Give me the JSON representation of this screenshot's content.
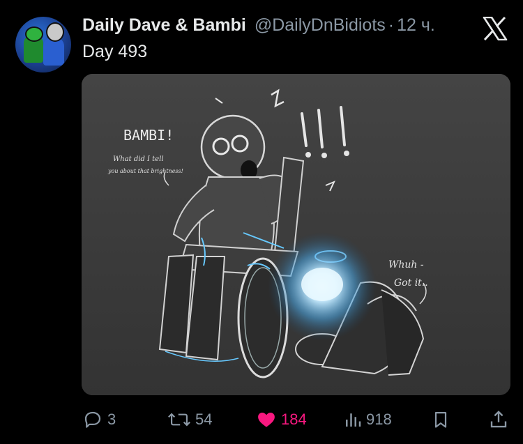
{
  "author": {
    "name": "Daily Dave & Bambi",
    "handle": "@DailyDnBidiots",
    "separator": "·",
    "time": "12 ч."
  },
  "tweet": {
    "text": "Day 493"
  },
  "media": {
    "drawn_text": {
      "shout": "BAMBI!",
      "scold_line1": "What did I tell",
      "scold_line2": "you about that brightness!",
      "reply_line1": "Whuh -",
      "reply_line2": "Got it.."
    }
  },
  "actions": {
    "replies": "3",
    "reposts": "54",
    "likes": "184",
    "views": "918"
  },
  "colors": {
    "background": "#000000",
    "text": "#e7e9ea",
    "muted": "#8b98a5",
    "like": "#f91880",
    "glow": "#bfe9ff"
  },
  "icons": [
    "x-logo-icon",
    "reply-icon",
    "repost-icon",
    "heart-icon",
    "views-icon",
    "bookmark-icon",
    "share-icon"
  ]
}
